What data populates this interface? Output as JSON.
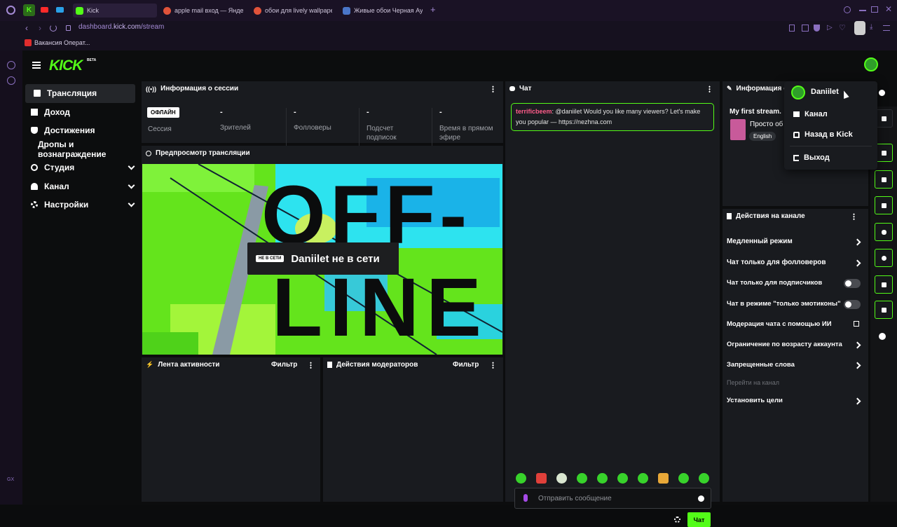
{
  "browser": {
    "tabs": [
      {
        "label": "Kick"
      },
      {
        "label": "apple mail вход — Яндекс"
      },
      {
        "label": "обои для lively wallpaper"
      },
      {
        "label": "Живые обои Черная Аура"
      }
    ],
    "url_prefix": "dashboard.",
    "url_host": "kick.com",
    "url_path": "/stream",
    "bookmark": "Вакансия Операт..."
  },
  "app": {
    "logo": "KICK",
    "logo_badge": "BETA",
    "nav": [
      {
        "label": "Трансляция",
        "active": true,
        "icon": "broadcast-icon"
      },
      {
        "label": "Доход",
        "icon": "revenue-icon"
      },
      {
        "label": "Достижения",
        "icon": "trophy-icon"
      },
      {
        "label": "Дропы и вознаграждение"
      },
      {
        "label": "Студия",
        "icon": "studio-icon",
        "expandable": true
      },
      {
        "label": "Канал",
        "icon": "channel-icon",
        "expandable": true
      },
      {
        "label": "Настройки",
        "icon": "gear-icon",
        "expandable": true
      }
    ]
  },
  "session": {
    "title": "Информация о сессии",
    "status_badge": "ОФЛАЙН",
    "session_label": "Сессия",
    "stats": [
      {
        "value": "-",
        "label": "Зрителей"
      },
      {
        "value": "-",
        "label": "Фолловеры"
      },
      {
        "value": "-",
        "label": "Подсчет подписок"
      },
      {
        "value": "-",
        "label": "Время в прямом эфире"
      }
    ]
  },
  "preview": {
    "title": "Предпросмотр трансляции",
    "badge": "НЕ В СЕТИ",
    "text": "Daniilet не в сети",
    "art_text_top": "OFF-",
    "art_text_bottom": "LINE"
  },
  "activity": {
    "title": "Лента активности",
    "filter": "Фильтр"
  },
  "modactions": {
    "title": "Действия модераторов",
    "filter": "Фильтр"
  },
  "chat": {
    "title": "Чат",
    "message": {
      "user": "terrificbeem",
      "text": ": @daniilet Would you like many viewers? Let's make you popular — https://nezhna.com"
    },
    "input_placeholder": "Отправить сообщение",
    "send_label": "Чат"
  },
  "stream_info": {
    "title": "Информация о",
    "stream_title": "My first stream.",
    "category": "Просто об",
    "language": "English"
  },
  "channel_actions": {
    "title": "Действия на канале",
    "items": [
      {
        "label": "Медленный режим",
        "control": "chevron"
      },
      {
        "label": "Чат только для фолловеров",
        "control": "chevron"
      },
      {
        "label": "Чат только для подписчиков",
        "control": "toggle"
      },
      {
        "label": "Чат в режиме \"только эмотиконы\"",
        "control": "toggle"
      },
      {
        "label": "Модерация чата с помощью ИИ",
        "control": "external"
      },
      {
        "label": "Ограничение по возрасту аккаунта",
        "control": "chevron"
      },
      {
        "label": "Запрещенные слова",
        "control": "chevron"
      },
      {
        "label": "Перейти на канал",
        "control": "none"
      },
      {
        "label": "Установить цели",
        "control": "chevron"
      }
    ]
  },
  "user_menu": {
    "username": "Daniilet",
    "items": [
      {
        "label": "Канал",
        "icon": "channel-icon"
      },
      {
        "label": "Назад в Kick",
        "icon": "home-icon"
      },
      {
        "label": "Выход",
        "icon": "logout-icon"
      }
    ]
  },
  "colors": {
    "accent": "#53fc18",
    "panel": "#191b1f",
    "background": "#0c0d0e"
  }
}
